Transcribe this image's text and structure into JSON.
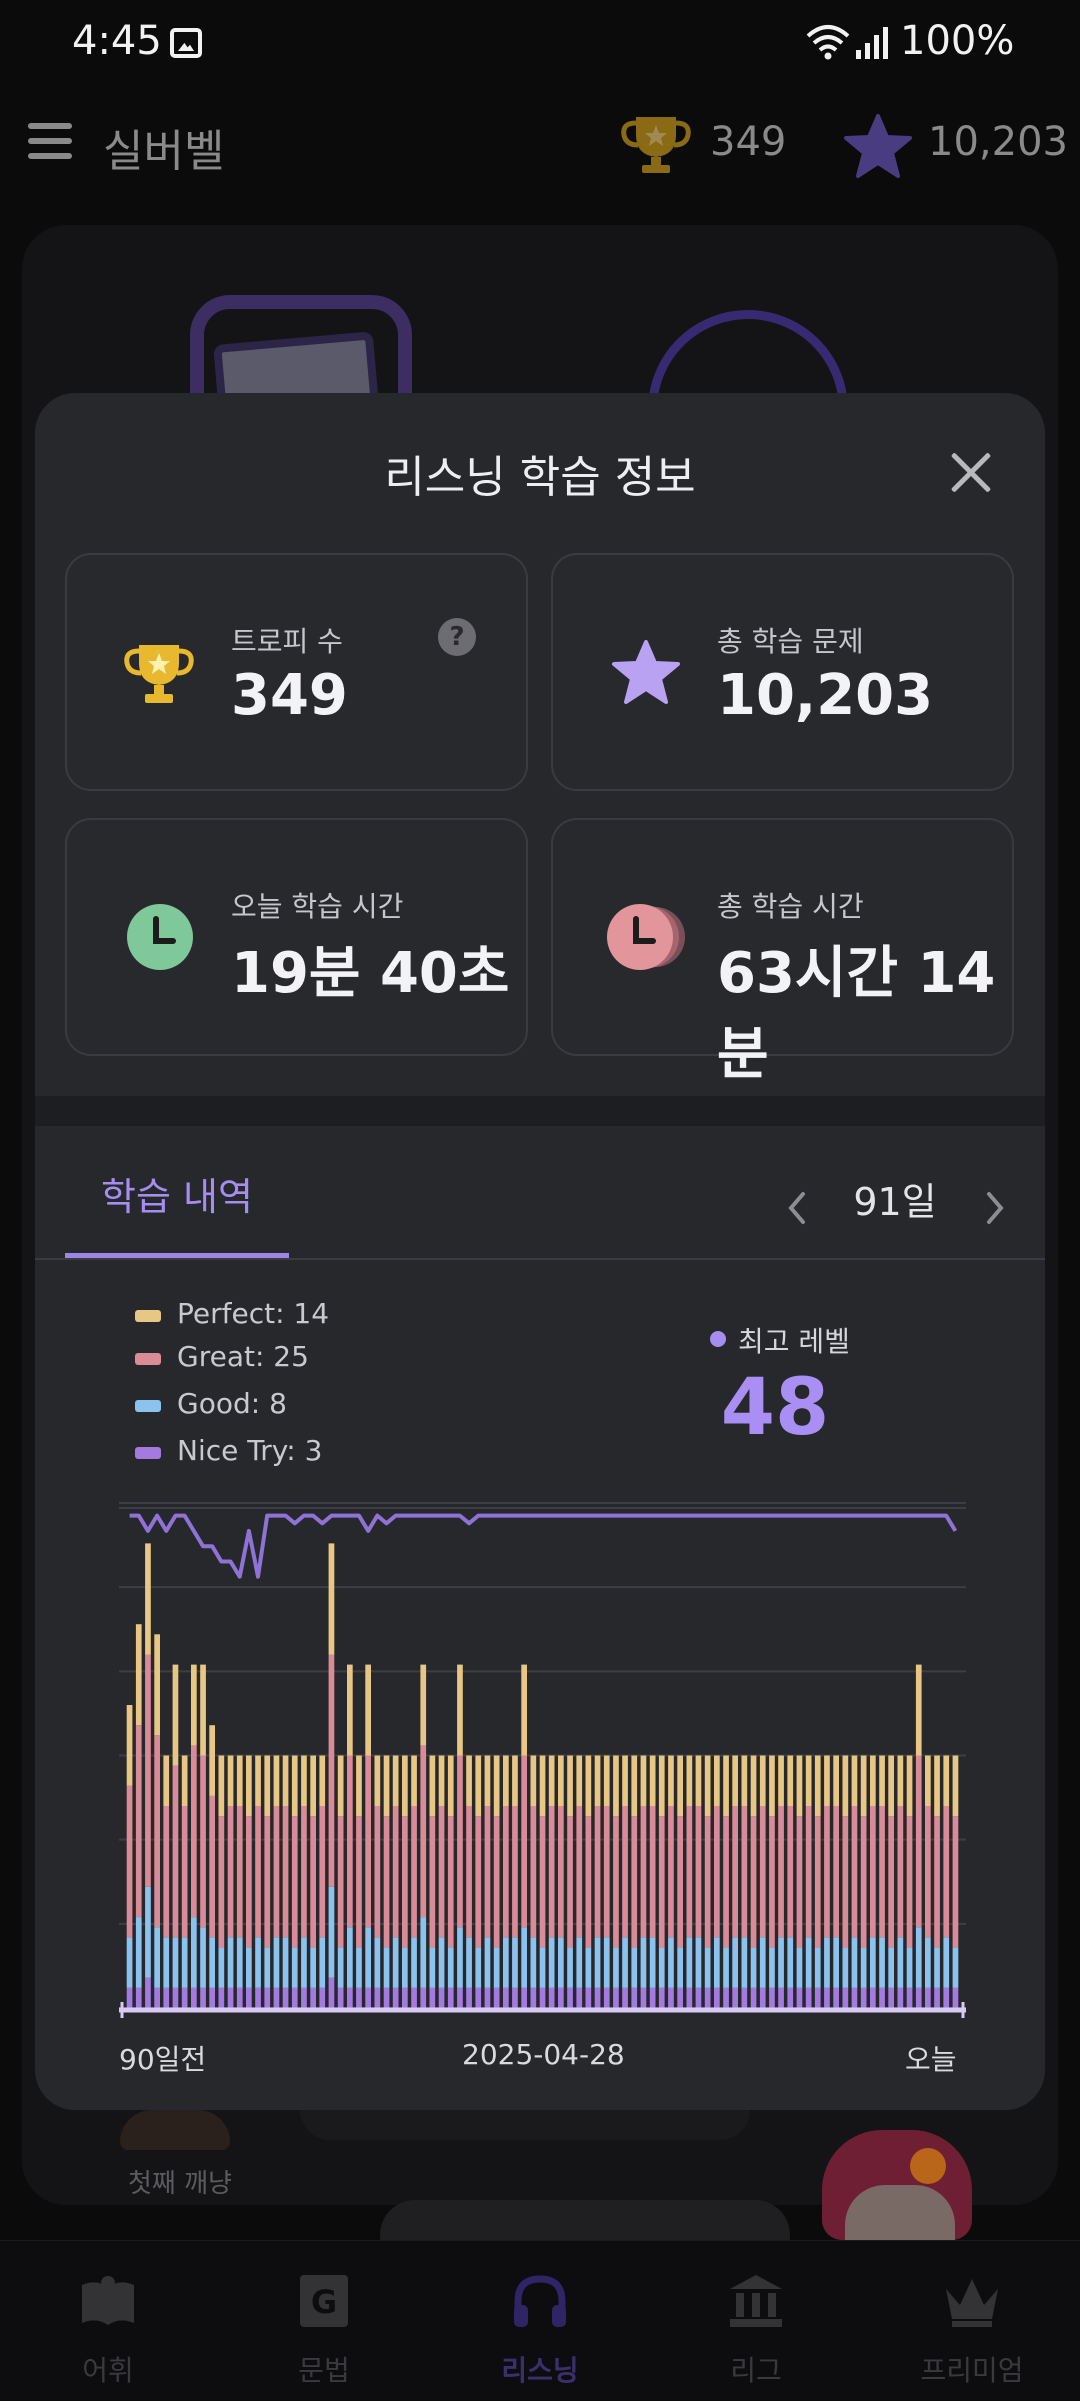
{
  "status_bar": {
    "time": "4:45",
    "battery": "100%"
  },
  "app_bar": {
    "title": "실버벨",
    "trophy_count": "349",
    "star_count": "10,203"
  },
  "modal": {
    "title": "리스닝 학습 정보",
    "stats": [
      {
        "label": "트로피 수",
        "value": "349",
        "icon": "trophy-icon"
      },
      {
        "label": "총 학습 문제",
        "value": "10,203",
        "icon": "star-icon"
      },
      {
        "label": "오늘 학습 시간",
        "value": "19분 40초",
        "icon": "clock-icon"
      },
      {
        "label": "총 학습 시간",
        "value": "63시간 14분",
        "icon": "clock-stack-icon"
      }
    ],
    "history_tab": "학습 내역",
    "period": "91일",
    "best_level_label": "최고 레벨",
    "best_level_value": "48"
  },
  "legend": [
    {
      "text": "Perfect: 14",
      "color": "#e8c785"
    },
    {
      "text": "Great: 25",
      "color": "#d98b98"
    },
    {
      "text": "Good: 8",
      "color": "#8cc3ee"
    },
    {
      "text": "Nice Try: 3",
      "color": "#a47ae0"
    }
  ],
  "chart_data": {
    "type": "bar",
    "stacked": true,
    "x_labels": [
      "90일전",
      "2025-04-28",
      "오늘"
    ],
    "series_names": [
      "Perfect",
      "Great",
      "Good",
      "Nice Try"
    ],
    "num_days": 91,
    "ylim": [
      0,
      50
    ],
    "gridlines": 6,
    "level_line": {
      "name": "최고 레벨",
      "ylim": [
        38,
        49
      ],
      "values": [
        48,
        48,
        46,
        48,
        46,
        48,
        48,
        46,
        44,
        44,
        42,
        42,
        40,
        46,
        40,
        48,
        48,
        48,
        47,
        48,
        48,
        47,
        48,
        48,
        48,
        48,
        46,
        48,
        47,
        48,
        48,
        48,
        48,
        48,
        48,
        48,
        48,
        47,
        48,
        48,
        48,
        48,
        48,
        48,
        48,
        48,
        48,
        48,
        48,
        48,
        48,
        48,
        48,
        48,
        48,
        48,
        48,
        48,
        48,
        48,
        48,
        48,
        48,
        48,
        48,
        48,
        48,
        48,
        48,
        48,
        48,
        48,
        48,
        48,
        48,
        48,
        48,
        48,
        48,
        48,
        48,
        48,
        48,
        48,
        48,
        48,
        48,
        48,
        48,
        48,
        46
      ]
    },
    "totals": [
      30,
      38,
      46,
      37,
      25,
      34,
      25,
      34,
      34,
      28,
      25,
      25,
      25,
      25,
      25,
      25,
      25,
      25,
      25,
      25,
      25,
      25,
      46,
      25,
      34,
      25,
      34,
      25,
      25,
      25,
      25,
      25,
      34,
      25,
      25,
      25,
      34,
      25,
      25,
      25,
      25,
      25,
      25,
      34,
      25,
      25,
      25,
      25,
      25,
      25,
      25,
      25,
      25,
      25,
      25,
      25,
      25,
      25,
      25,
      25,
      25,
      25,
      25,
      25,
      25,
      25,
      25,
      25,
      25,
      25,
      25,
      25,
      25,
      25,
      25,
      25,
      25,
      25,
      25,
      25,
      25,
      25,
      25,
      25,
      25,
      25,
      34,
      25,
      25,
      25,
      25
    ]
  },
  "bottom_nav": [
    {
      "label": "어휘",
      "icon": "book-icon"
    },
    {
      "label": "문법",
      "icon": "grammar-icon"
    },
    {
      "label": "리스닝",
      "icon": "headphones-icon"
    },
    {
      "label": "리그",
      "icon": "league-icon"
    },
    {
      "label": "프리미엄",
      "icon": "crown-icon"
    }
  ],
  "background": {
    "peek_name": "첫째 깨냥"
  }
}
